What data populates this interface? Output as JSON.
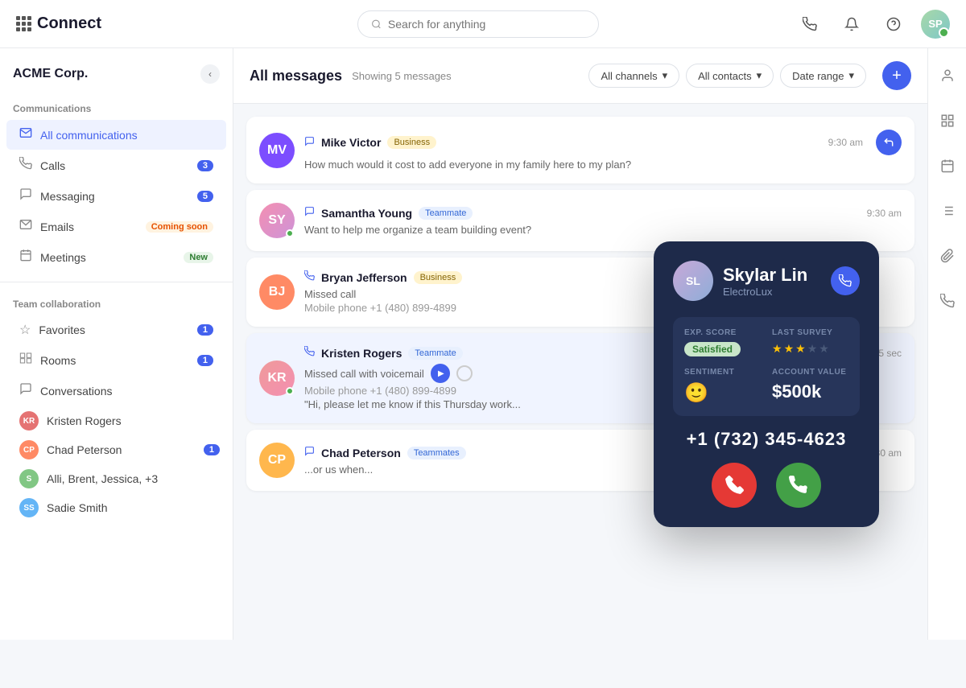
{
  "header": {
    "logo": "Connect",
    "search_placeholder": "Search for anything",
    "user_initials": "SP"
  },
  "sidebar": {
    "company": "ACME Corp.",
    "communications_title": "Communications",
    "nav_items": [
      {
        "id": "all-communications",
        "label": "All communications",
        "icon": "✉",
        "active": true,
        "badge": null
      },
      {
        "id": "calls",
        "label": "Calls",
        "icon": "📞",
        "active": false,
        "badge": "3"
      },
      {
        "id": "messaging",
        "label": "Messaging",
        "icon": "💬",
        "active": false,
        "badge": "5"
      },
      {
        "id": "emails",
        "label": "Emails",
        "icon": "📧",
        "active": false,
        "badge_type": "coming-soon",
        "badge_label": "Coming soon"
      },
      {
        "id": "meetings",
        "label": "Meetings",
        "icon": "🗓",
        "active": false,
        "badge_type": "new",
        "badge_label": "New"
      }
    ],
    "team_section_title": "Team collaboration",
    "team_items": [
      {
        "id": "favorites",
        "icon": "☆",
        "label": "Favorites",
        "badge": "1",
        "type": "icon"
      },
      {
        "id": "rooms",
        "icon": "▦",
        "label": "Rooms",
        "badge": "1",
        "type": "icon"
      },
      {
        "id": "conversations",
        "label": "Conversations",
        "icon": "💬",
        "type": "icon-label"
      }
    ],
    "conversations": [
      {
        "id": "kristen-rogers",
        "name": "Kristen Rogers",
        "color": "#e57373",
        "initials": "KR",
        "badge": null
      },
      {
        "id": "chad-peterson",
        "name": "Chad Peterson",
        "color": "#ff8a65",
        "initials": "CP",
        "badge": "1"
      },
      {
        "id": "group",
        "name": "Alli, Brent, Jessica, +3",
        "color": "#81c784",
        "initials": "S",
        "badge": null
      },
      {
        "id": "sadie-smith",
        "name": "Sadie Smith",
        "color": "#64b5f6",
        "initials": "SS",
        "badge": null
      }
    ]
  },
  "main": {
    "title": "All messages",
    "showing_label": "Showing 5 messages",
    "filters": [
      {
        "label": "All channels",
        "id": "all-channels"
      },
      {
        "label": "All contacts",
        "id": "all-contacts"
      },
      {
        "label": "Date range",
        "id": "date-range"
      }
    ],
    "messages": [
      {
        "id": "msg-mike-victor",
        "name": "Mike Victor",
        "tag": "Business",
        "tag_type": "business",
        "time": "9:30 am",
        "preview": "How much would it cost to add everyone in my family here to my plan?",
        "channel": "message",
        "avatar_color": "#7c4dff",
        "avatar_initials": "MV",
        "has_reply": true
      },
      {
        "id": "msg-samantha-young",
        "name": "Samantha Young",
        "tag": "Teammate",
        "tag_type": "teammate",
        "time": "9:30 am",
        "preview": "Want to help me organize a team building event?",
        "channel": "message",
        "avatar_color": "#f48fb1",
        "avatar_initials": "SY",
        "online": true
      },
      {
        "id": "msg-bryan-jefferson",
        "name": "Bryan Jefferson",
        "tag": "Business",
        "tag_type": "business",
        "time": "",
        "preview": "Missed call",
        "sub_preview": "Mobile phone +1 (480) 899-4899",
        "channel": "phone",
        "avatar_color": "#ff8a65",
        "avatar_initials": "BJ"
      },
      {
        "id": "msg-kristen-rogers",
        "name": "Kristen Rogers",
        "tag": "Teammate",
        "tag_type": "teammate",
        "time": "15 sec",
        "preview": "Missed call with voicemail",
        "sub_preview": "Mobile phone +1 (480) 899-4899",
        "extra_preview": "\"Hi, please let me know if this Thursday work...",
        "channel": "phone",
        "avatar_color": "#ef9a9a",
        "avatar_initials": "KR",
        "online": true,
        "has_voicemail": true
      },
      {
        "id": "msg-chad-peterson",
        "name": "Chad Peterson",
        "tag": "Teammates",
        "tag_type": "teammates",
        "time": "9:30 am",
        "preview": "...or us when...",
        "channel": "message",
        "avatar_color": "#ffb74d",
        "avatar_initials": "CP"
      }
    ]
  },
  "calling_card": {
    "name": "Skylar Lin",
    "company": "ElectroLux",
    "avatar_initials": "SL",
    "exp_score_label": "EXP. SCORE",
    "exp_score_value": "Satisfied",
    "last_survey_label": "LAST SURVEY",
    "stars_filled": 3,
    "stars_total": 5,
    "sentiment_label": "SENTIMENT",
    "sentiment_emoji": "🙂",
    "account_value_label": "ACCOUNT VALUE",
    "account_value": "$500k",
    "phone_number": "+1 (732) 345-4623",
    "decline_icon": "📵",
    "accept_icon": "📞"
  },
  "right_sidebar": {
    "icons": [
      {
        "id": "person-icon",
        "symbol": "👤"
      },
      {
        "id": "grid-icon",
        "symbol": "⊞"
      },
      {
        "id": "calendar-icon",
        "symbol": "📅"
      },
      {
        "id": "list-icon",
        "symbol": "☰"
      },
      {
        "id": "clip-icon",
        "symbol": "📎"
      },
      {
        "id": "phone-icon",
        "symbol": "📞"
      }
    ]
  }
}
